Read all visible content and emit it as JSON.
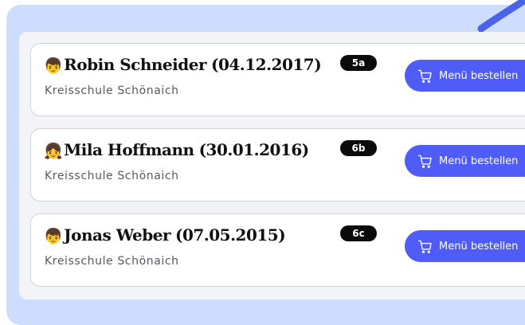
{
  "students": [
    {
      "emoji": "👦",
      "name": "Robin Schneider",
      "birthdate": "(04.12.2017)",
      "school": "Kreisschule Schönaich",
      "class": "5a",
      "order_label": "Menü bestellen"
    },
    {
      "emoji": "👧",
      "name": "Mila Hoffmann",
      "birthdate": "(30.01.2016)",
      "school": "Kreisschule Schönaich",
      "class": "6b",
      "order_label": "Menü bestellen"
    },
    {
      "emoji": "👦",
      "name": "Jonas Weber",
      "birthdate": "(07.05.2015)",
      "school": "Kreisschule Schönaich",
      "class": "6c",
      "order_label": "Menü bestellen"
    }
  ],
  "icons": {
    "order": "shopping-cart-icon"
  },
  "colors": {
    "background": "#cddcff",
    "panel": "#f2f4f8",
    "button": "#4f5cf7",
    "badge": "#0b0b0b",
    "accent_swoosh": "#4a63e8"
  }
}
